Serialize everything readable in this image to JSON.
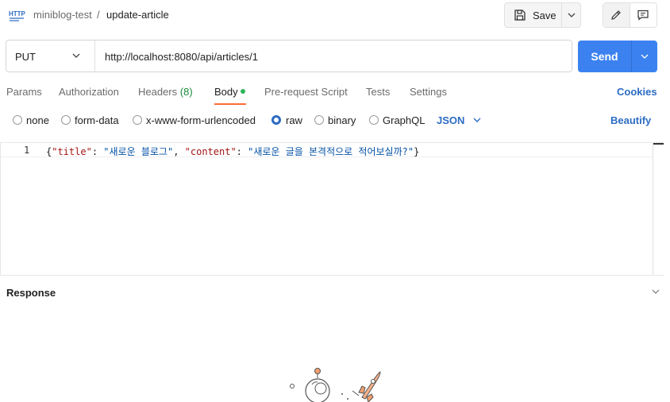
{
  "header": {
    "icon_label": "HTTP",
    "collection": "miniblog-test",
    "separator": "/",
    "request_name": "update-article",
    "save_label": "Save"
  },
  "request": {
    "method": "PUT",
    "url": "http://localhost:8080/api/articles/1",
    "send_label": "Send"
  },
  "tabs": {
    "params": "Params",
    "authorization": "Authorization",
    "headers": "Headers",
    "headers_count": "(8)",
    "body": "Body",
    "prerequest": "Pre-request Script",
    "tests": "Tests",
    "settings": "Settings",
    "cookies": "Cookies",
    "active": "Body"
  },
  "body_options": {
    "none": "none",
    "form_data": "form-data",
    "urlencoded": "x-www-form-urlencoded",
    "raw": "raw",
    "binary": "binary",
    "graphql": "GraphQL",
    "selected": "raw",
    "format": "JSON",
    "beautify": "Beautify"
  },
  "editor": {
    "line_number": "1",
    "tokens": {
      "open": "{",
      "k1": "\"title\"",
      "c1": ": ",
      "v1": "\"새로운 블로그\"",
      "comma": ", ",
      "k2": "\"content\"",
      "c2": ": ",
      "v2": "\"새로운 글을 본격적으로 적어보실까?\"",
      "close": "}"
    }
  },
  "response": {
    "title": "Response"
  },
  "colors": {
    "accent_blue": "#3b82f0",
    "link_blue": "#2c6cc4",
    "tab_underline": "#ff6c37",
    "status_dot": "#2db55d"
  },
  "icons": [
    "http-icon",
    "save-icon",
    "chevron-down-icon",
    "pencil-icon",
    "comment-icon",
    "rocket-illustration"
  ]
}
